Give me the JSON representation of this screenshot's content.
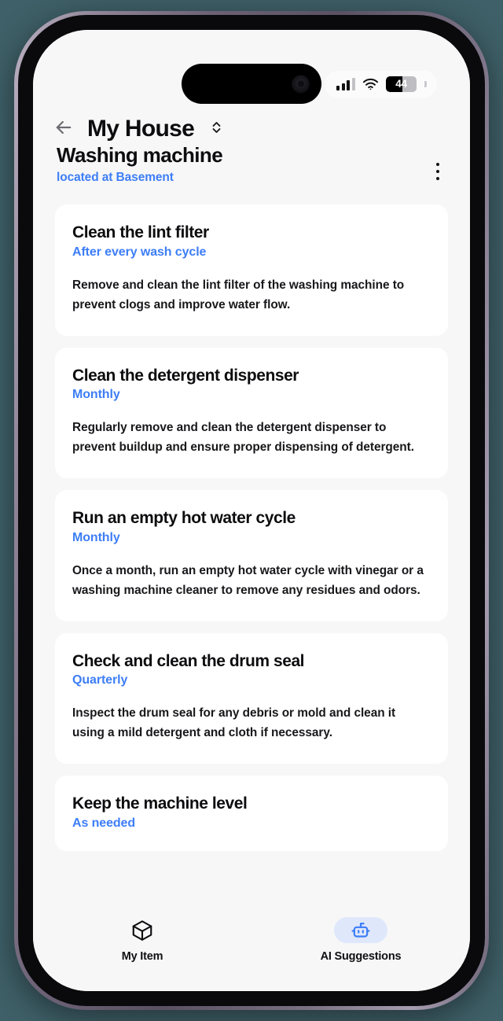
{
  "status_bar": {
    "signal_icon": "cellular-signal-icon",
    "signal_bars_active": 3,
    "signal_bars_total": 4,
    "wifi_icon": "wifi-icon",
    "battery_level": "44",
    "battery_percent": 44
  },
  "nav": {
    "back_icon": "arrow-left-icon",
    "title": "My House",
    "sort_icon": "chevron-up-down-icon"
  },
  "page": {
    "title": "Washing machine",
    "subtitle": "located at Basement",
    "menu_icon": "more-vertical-icon"
  },
  "cards": [
    {
      "title": "Clean the lint filter",
      "frequency": "After every wash cycle",
      "description": "Remove and clean the lint filter of the washing machine to prevent clogs and improve water flow."
    },
    {
      "title": "Clean the detergent dispenser",
      "frequency": "Monthly",
      "description": "Regularly remove and clean the detergent dispenser to prevent buildup and ensure proper dispensing of detergent."
    },
    {
      "title": "Run an empty hot water cycle",
      "frequency": "Monthly",
      "description": "Once a month, run an empty hot water cycle with vinegar or a washing machine cleaner to remove any residues and odors."
    },
    {
      "title": "Check and clean the drum seal",
      "frequency": "Quarterly",
      "description": "Inspect the drum seal for any debris or mold and clean it using a mild detergent and cloth if necessary."
    },
    {
      "title": "Keep the machine level",
      "frequency": "As needed",
      "description": ""
    }
  ],
  "tabs": [
    {
      "label": "My Item",
      "icon": "cube-icon",
      "active": false
    },
    {
      "label": "AI Suggestions",
      "icon": "robot-icon",
      "active": true
    }
  ],
  "colors": {
    "accent_blue": "#3d7ef7",
    "accent_pill": "#dfe7fb",
    "screen_bg": "#f7f7f8",
    "card_bg": "#ffffff",
    "text_primary": "#0d0d0f",
    "outside_bg": "#3f6068"
  }
}
